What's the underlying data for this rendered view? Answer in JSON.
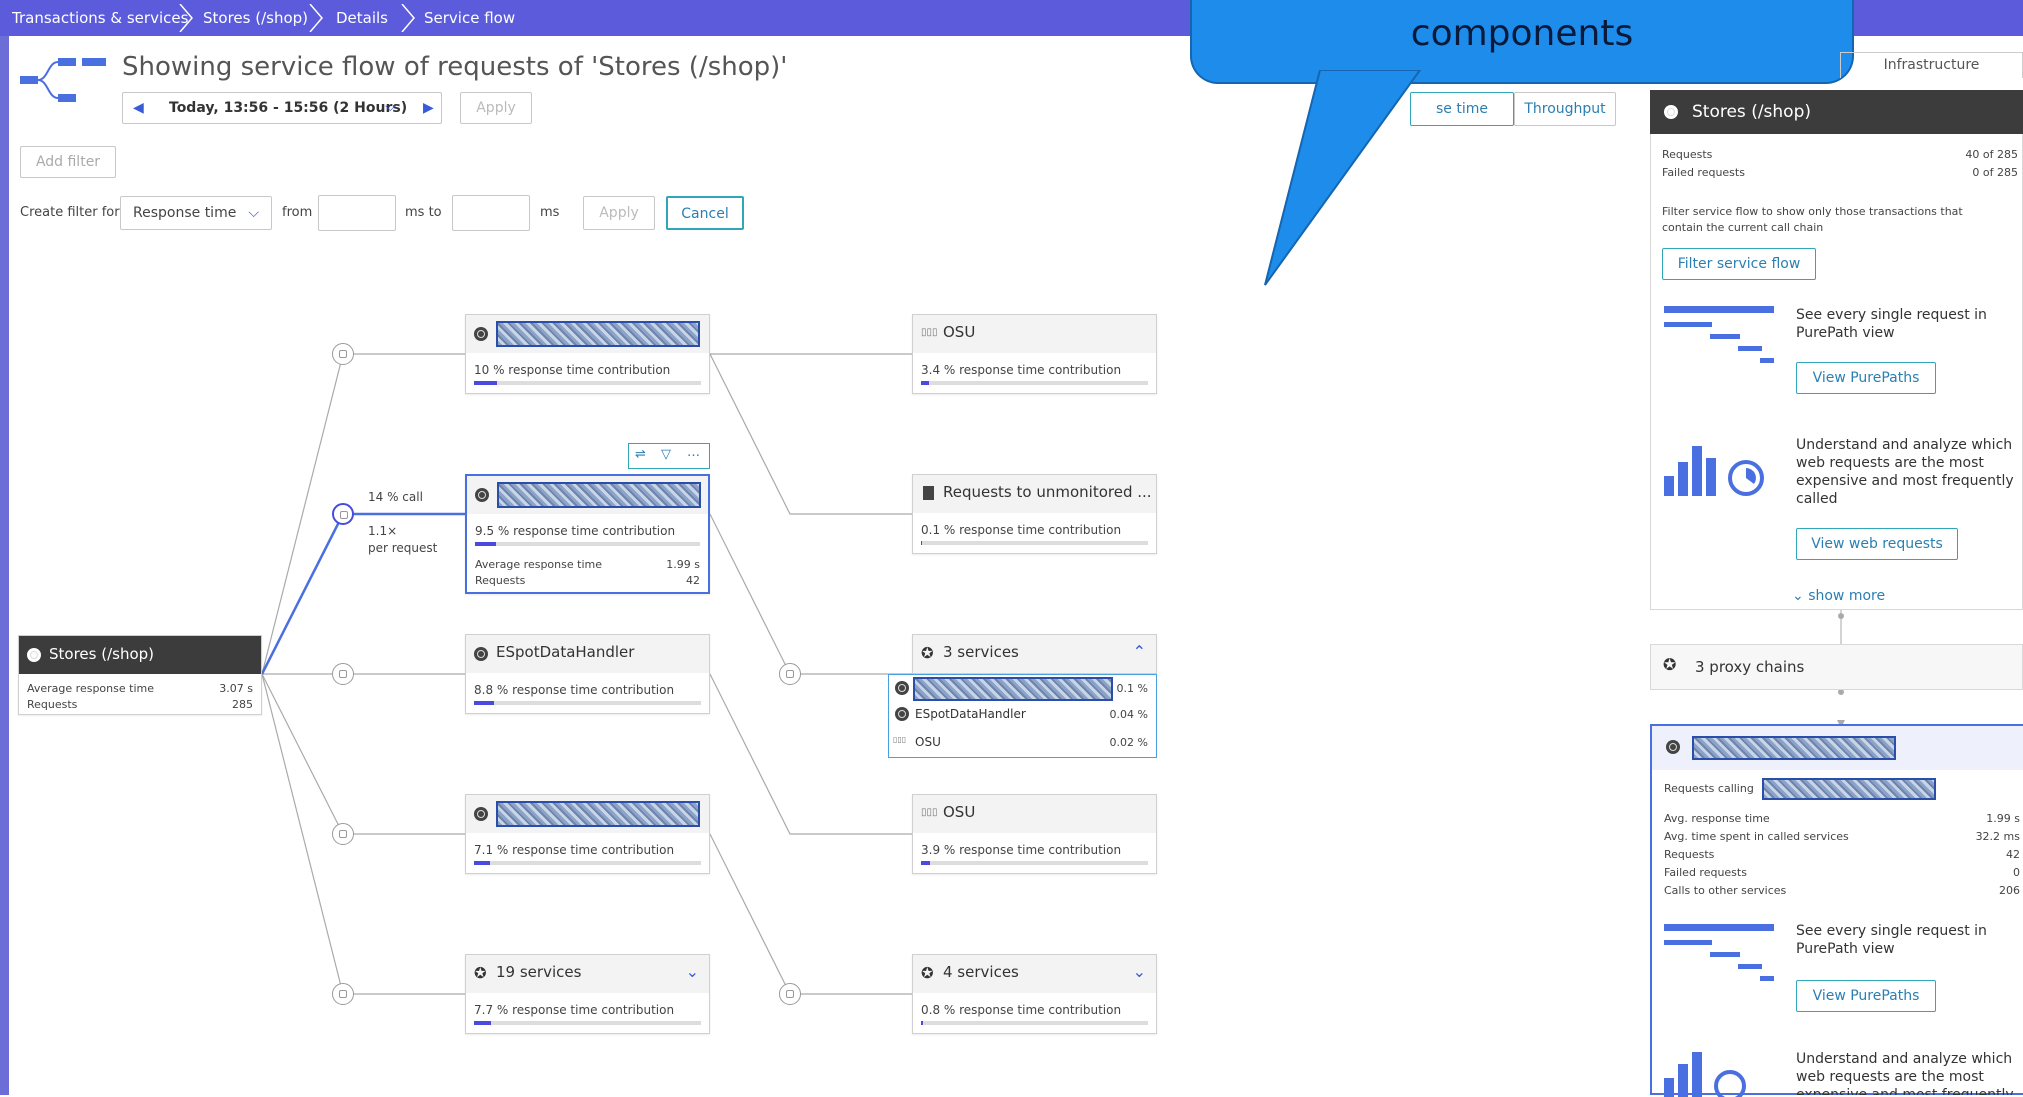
{
  "breadcrumb": [
    "Transactions & services",
    "Stores (/shop)",
    "Details",
    "Service flow"
  ],
  "header": {
    "title": "Showing service flow of requests of 'Stores (/shop)'",
    "timeframe": "Today, 13:56 - 15:56 (2 Hours)",
    "apply": "Apply",
    "add_filter": "Add filter"
  },
  "filter": {
    "create_label": "Create filter for",
    "type": "Response time",
    "from": "from",
    "ms_to": "ms  to",
    "ms": "ms",
    "apply": "Apply",
    "cancel": "Cancel"
  },
  "callout": "components",
  "tabs": {
    "response_time": "se time",
    "throughput": "Throughput",
    "infrastructure": "Infrastructure"
  },
  "source": {
    "name": "Stores (/shop)",
    "avg_label": "Average response time",
    "avg": "3.07 s",
    "req_label": "Requests",
    "req": "285"
  },
  "edge_label": {
    "call": "14 % call",
    "per": "1.1×",
    "per2": "per request"
  },
  "col1": [
    {
      "contrib": "10 % response time contribution",
      "pct": 10
    },
    {
      "contrib": "9.5 % response time contribution",
      "pct": 9.5,
      "avg_label": "Average response time",
      "avg": "1.99 s",
      "req_label": "Requests",
      "req": "42"
    },
    {
      "name": "ESpotDataHandler",
      "contrib": "8.8 % response time contribution",
      "pct": 8.8
    },
    {
      "contrib": "7.1 % response time contribution",
      "pct": 7.1
    },
    {
      "name": "19 services",
      "contrib": "7.7 % response time contribution",
      "pct": 7.7
    }
  ],
  "col2": [
    {
      "name": "OSU",
      "contrib": "3.4 % response time contribution",
      "pct": 3.4
    },
    {
      "name": "Requests to unmonitored ...",
      "contrib": "0.1 % response time contribution",
      "pct": 0.1
    },
    {
      "name": "3 services",
      "rows": [
        {
          "name": "",
          "val": "0.1 %"
        },
        {
          "name": "ESpotDataHandler",
          "val": "0.04 %"
        },
        {
          "name": "OSU",
          "val": "0.02 %"
        }
      ]
    },
    {
      "name": "OSU",
      "contrib": "3.9 % response time contribution",
      "pct": 3.9
    },
    {
      "name": "4 services",
      "contrib": "0.8 % response time contribution",
      "pct": 0.8
    }
  ],
  "panel": {
    "title": "Stores (/shop)",
    "requests_label": "Requests",
    "requests": "40 of 285",
    "failed_label": "Failed requests",
    "failed": "0 of 285",
    "filter_text": "Filter service flow to show only those transactions that contain the current call chain",
    "filter_btn": "Filter service flow",
    "pp_text": "See every single request in PurePath view",
    "pp_btn": "View PurePaths",
    "wr_text": "Understand and analyze which web requests are the most expensive and most frequently called",
    "wr_btn": "View web requests",
    "show_more": "show more",
    "proxy": "3 proxy chains",
    "svc_calling": "Requests calling",
    "avg_label": "Avg. response time",
    "avg": "1.99 s",
    "spent_label": "Avg. time spent in called services",
    "spent": "32.2 ms",
    "req_label": "Requests",
    "req": "42",
    "fail_label": "Failed requests",
    "fail": "0",
    "calls_label": "Calls to other services",
    "calls": "206",
    "pp_text2": "See every single request in PurePath view",
    "pp_btn2": "View PurePaths",
    "wr_text2": "Understand and analyze which web requests are the most expensive and most frequently"
  }
}
